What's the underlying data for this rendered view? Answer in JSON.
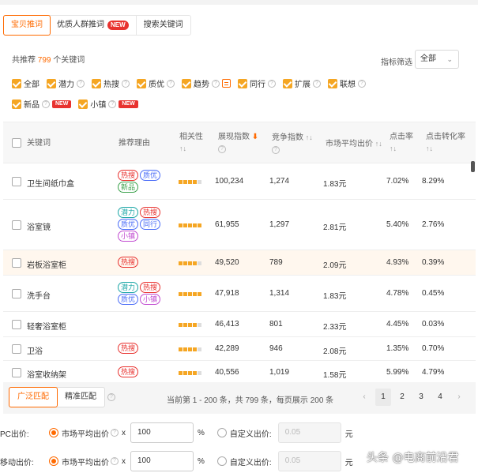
{
  "tabs": [
    {
      "label": "宝贝推词",
      "active": true
    },
    {
      "label": "优质人群推词",
      "badge": "NEW"
    },
    {
      "label": "搜索关键词"
    }
  ],
  "summary": {
    "prefix": "共推荐",
    "count": "799",
    "suffix": "个关键词"
  },
  "filter": {
    "label": "指标筛选",
    "value": "全部"
  },
  "checks_row1": [
    {
      "label": "全部"
    },
    {
      "label": "潜力"
    },
    {
      "label": "热搜"
    },
    {
      "label": "质优"
    },
    {
      "label": "趋势"
    },
    {
      "label": "同行"
    },
    {
      "label": "扩展"
    },
    {
      "label": "联想"
    }
  ],
  "checks_row2": [
    {
      "label": "新品",
      "badge": "NEW"
    },
    {
      "label": "小镇",
      "badge": "NEW"
    }
  ],
  "columns": {
    "keyword": "关键词",
    "reason": "推荐理由",
    "relevance": "相关性",
    "impressions": "展现指数",
    "competition": "竞争指数",
    "avg_bid": "市场平均出价",
    "ctr": "点击率",
    "cvr": "点击转化率"
  },
  "rows": [
    {
      "keyword": "卫生间纸巾盒",
      "tags": [
        [
          "热搜",
          "hot"
        ],
        [
          "质优",
          "good"
        ],
        [
          "新品",
          "new"
        ]
      ],
      "relevance": 4,
      "impressions": "100,234",
      "competition": "1,274",
      "avg_bid": "1.83元",
      "ctr": "7.02%",
      "cvr": "8.29%"
    },
    {
      "keyword": "浴室镜",
      "tags": [
        [
          "潜力",
          "pot"
        ],
        [
          "热搜",
          "hot"
        ],
        [
          "质优",
          "good"
        ],
        [
          "同行",
          "same"
        ],
        [
          "小镇",
          "town"
        ]
      ],
      "relevance": 5,
      "impressions": "61,955",
      "competition": "1,297",
      "avg_bid": "2.81元",
      "ctr": "5.40%",
      "cvr": "2.76%"
    },
    {
      "keyword": "岩板浴室柜",
      "tags": [
        [
          "热搜",
          "hot"
        ]
      ],
      "relevance": 4,
      "impressions": "49,520",
      "competition": "789",
      "avg_bid": "2.09元",
      "ctr": "4.93%",
      "cvr": "0.39%"
    },
    {
      "keyword": "洗手台",
      "tags": [
        [
          "潜力",
          "pot"
        ],
        [
          "热搜",
          "hot"
        ],
        [
          "质优",
          "good"
        ],
        [
          "小镇",
          "town"
        ]
      ],
      "relevance": 5,
      "impressions": "47,918",
      "competition": "1,314",
      "avg_bid": "1.83元",
      "ctr": "4.78%",
      "cvr": "0.45%"
    },
    {
      "keyword": "轻奢浴室柜",
      "tags": [],
      "relevance": 4,
      "impressions": "46,413",
      "competition": "801",
      "avg_bid": "2.33元",
      "ctr": "4.45%",
      "cvr": "0.03%"
    },
    {
      "keyword": "卫浴",
      "tags": [
        [
          "热搜",
          "hot"
        ]
      ],
      "relevance": 4,
      "impressions": "42,289",
      "competition": "946",
      "avg_bid": "2.08元",
      "ctr": "1.35%",
      "cvr": "0.70%"
    },
    {
      "keyword": "浴室收纳架",
      "tags": [
        [
          "热搜",
          "hot"
        ]
      ],
      "relevance": 4,
      "impressions": "40,556",
      "competition": "1,019",
      "avg_bid": "1.58元",
      "ctr": "5.99%",
      "cvr": "4.79%"
    }
  ],
  "bottom": {
    "broad": "广泛匹配",
    "exact": "精准匹配",
    "page_info": "当前第 1 - 200 条，共 799 条，每页展示 200 条",
    "pages": [
      "1",
      "2",
      "3",
      "4"
    ]
  },
  "bid_pc": {
    "label": "PC出价:",
    "market": "市场平均出价",
    "x": "x",
    "value": "100",
    "pct": "%",
    "custom": "自定义出价:",
    "custom_value": "0.05",
    "unit": "元"
  },
  "bid_mobile": {
    "label": "移动出价:",
    "market": "市场平均出价",
    "x": "x",
    "value": "100",
    "pct": "%",
    "custom": "自定义出价:",
    "custom_value": "0.05",
    "unit": "元"
  },
  "watermark": "头条 @电商前沿君"
}
